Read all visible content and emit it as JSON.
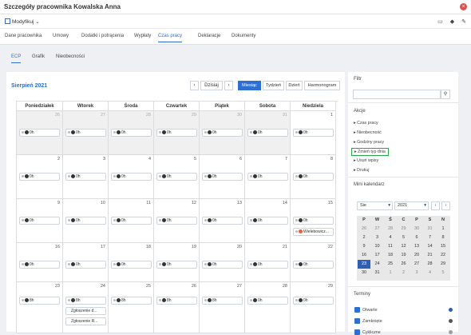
{
  "title": "Szczegóły pracownika Kowalska Anna",
  "toolbar": {
    "modify": "Modyfikuj"
  },
  "tabs": [
    "Dane pracownika",
    "Umowy",
    "Dodatki i potrącenia",
    "Wypłaty",
    "Czas pracy",
    "Deklaracje",
    "Dokumenty"
  ],
  "subtabs": [
    "ECP",
    "Grafik",
    "Nieobecności"
  ],
  "calendar": {
    "month": "Sierpień 2021",
    "today": "Dzisiaj",
    "views": [
      "Miesiąc",
      "Tydzień",
      "Dzień",
      "Harmonogram"
    ],
    "days": [
      "Poniedziałek",
      "Wtorek",
      "Środa",
      "Czwartek",
      "Piątek",
      "Sobota",
      "Niedziela"
    ],
    "weeks": [
      [
        "26",
        "27",
        "28",
        "29",
        "30",
        "31",
        "1"
      ],
      [
        "2",
        "3",
        "4",
        "5",
        "6",
        "7",
        "8"
      ],
      [
        "9",
        "10",
        "11",
        "12",
        "13",
        "14",
        "15"
      ],
      [
        "16",
        "17",
        "18",
        "19",
        "20",
        "21",
        "22"
      ],
      [
        "23",
        "24",
        "25",
        "26",
        "27",
        "28",
        "29"
      ]
    ],
    "ev0": "0h",
    "ev8": "8h",
    "absence": "Wielebowicz...",
    "request1": "Zgłoszenie d...",
    "request2": "Zgłoszenie R..."
  },
  "side": {
    "filter": "Filtr",
    "akcje": "Akcje",
    "actions": [
      "Czas pracy",
      "Nieobecność",
      "Godziny pracy",
      "Zmień typ dnia",
      "Usuń wpisy",
      "Drukuj"
    ],
    "mini": "Mini kalendarz",
    "mini_month": "Sie",
    "mini_year": "2021",
    "mini_days": [
      "P",
      "W",
      "Ś",
      "C",
      "P",
      "S",
      "N"
    ],
    "mini_weeks": [
      [
        "26",
        "27",
        "28",
        "29",
        "30",
        "31",
        "1"
      ],
      [
        "2",
        "3",
        "4",
        "5",
        "6",
        "7",
        "8"
      ],
      [
        "9",
        "10",
        "11",
        "12",
        "13",
        "14",
        "15"
      ],
      [
        "16",
        "17",
        "18",
        "19",
        "20",
        "21",
        "22"
      ],
      [
        "23",
        "24",
        "25",
        "26",
        "27",
        "28",
        "29"
      ],
      [
        "30",
        "31",
        "1",
        "2",
        "3",
        "4",
        "5"
      ]
    ],
    "terminy": "Terminy",
    "terms": [
      "Otwarte",
      "Zamknięte",
      "Cykliczne"
    ],
    "colors": {
      "open": "#2f5fb3",
      "closed": "#555555",
      "cyclic": "#9e9e9e"
    }
  }
}
